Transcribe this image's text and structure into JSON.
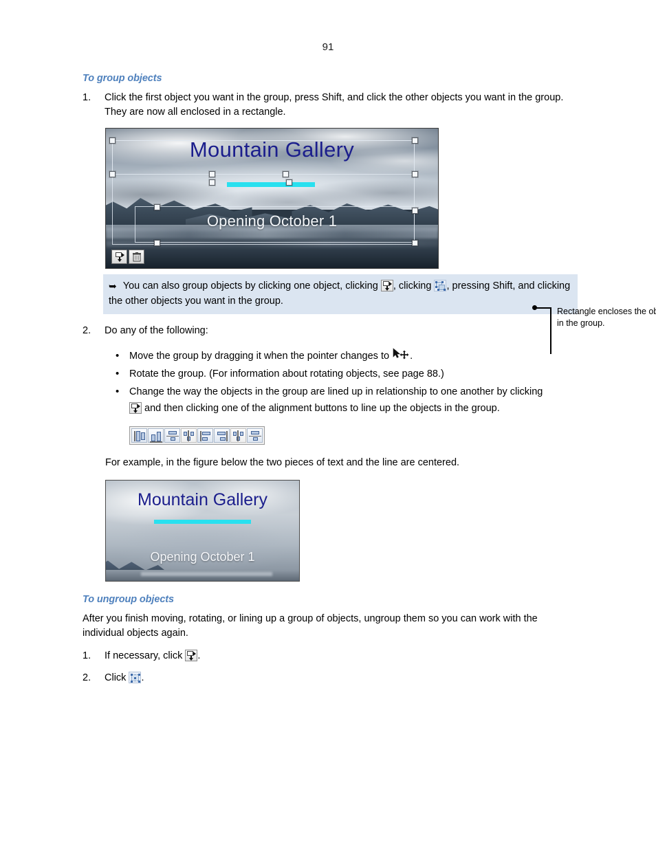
{
  "page": {
    "number": "91"
  },
  "sections": [
    {
      "heading": "To group objects",
      "steps": [
        {
          "num": "1.",
          "text": "Click the first object you want in the group, press Shift, and click the other objects you want in the group. They are now all enclosed in a rectangle."
        },
        {
          "num": "2.",
          "text": "Do any of the following:"
        }
      ]
    },
    {
      "heading": "To ungroup objects"
    }
  ],
  "figure1": {
    "title": "Mountain Gallery",
    "subtitle": "Opening October 1",
    "toolbar": {
      "arrange_icon": "arrange-objects-icon",
      "delete_icon": "trash-icon"
    },
    "callout": "Rectangle encloses the objects in the group."
  },
  "tip": {
    "arrow_glyph": "➥",
    "text_part1": "You can also group objects by clicking one object, clicking",
    "text_part2": ", clicking",
    "text_part3": ", pressing Shift, and clicking the other objects you want in the group.",
    "icon1": "arrange-objects-icon",
    "icon2": "group-objects-icon",
    "background_color": "#dbe5f1"
  },
  "bullets": [
    {
      "dot": "•",
      "text_before": "Move the group by dragging it when the pointer changes to",
      "icon": "move-cursor-icon",
      "text_after": "."
    },
    {
      "dot": "•",
      "text_before": "Rotate the group. (For information about rotating objects, see page 88.)",
      "icon": "",
      "text_after": ""
    },
    {
      "dot": "•",
      "text_before": "Change the way the objects in the group are lined up in relationship to one another by clicking",
      "icon": "arrange-objects-icon",
      "text_after": "and then clicking one of the alignment buttons to line up the objects in the group."
    }
  ],
  "alignment_toolbar": {
    "buttons": [
      {
        "name": "align-left-icon",
        "tooltip": "Align Left"
      },
      {
        "name": "align-center-horizontal-icon",
        "tooltip": "Align Center"
      },
      {
        "name": "align-middle-icon",
        "tooltip": "Align Middle"
      },
      {
        "name": "distribute-horizontal-icon",
        "tooltip": "Distribute Horizontally"
      },
      {
        "name": "align-top-icon",
        "tooltip": "Align Top"
      },
      {
        "name": "align-bottom-icon",
        "tooltip": "Align Bottom"
      },
      {
        "name": "distribute-vertical-icon",
        "tooltip": "Distribute Vertically"
      },
      {
        "name": "align-center-vertical-icon",
        "tooltip": "Align Center Vertical"
      }
    ]
  },
  "example_caption": "For example, in the figure below the two pieces of text and the line are centered.",
  "figure2": {
    "title": "Mountain Gallery",
    "subtitle": "Opening October 1"
  },
  "ungroup": {
    "intro": "After you finish moving, rotating, or lining up a group of objects, ungroup them so you can work with the individual objects again.",
    "steps": [
      {
        "num": "1.",
        "text_before": "If necessary, click",
        "icon": "arrange-objects-icon",
        "text_after": "."
      },
      {
        "num": "2.",
        "text_before": "Click",
        "icon": "ungroup-objects-icon",
        "text_after": "."
      }
    ]
  },
  "colors": {
    "heading": "#4f81bd",
    "tip_background": "#dbe5f1",
    "figure_title": "#1b1e8c",
    "figure_accent_line": "#29e0ef"
  }
}
